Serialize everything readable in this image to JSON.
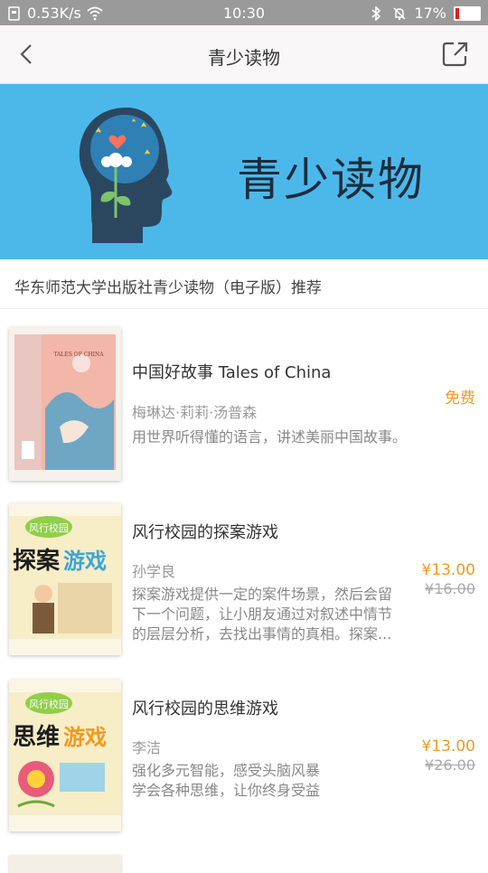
{
  "status_bar": {
    "speed": "0.53K/s",
    "time": "10:30",
    "battery": "17%",
    "battery_level": 0.17
  },
  "nav": {
    "title": "青少读物"
  },
  "banner": {
    "title": "青少读物",
    "bg_color": "#4cb8ea"
  },
  "section": {
    "description": "华东师范大学出版社青少读物（电子版）推荐"
  },
  "books": [
    {
      "title": "中国好故事 Tales of China",
      "author": "梅琳达·莉莉·汤普森",
      "desc": "用世界听得懂的语言，讲述美丽中国故事。",
      "price": "免费",
      "cover_title": "TALES OF CHINA"
    },
    {
      "title": "风行校园的探案游戏",
      "author": "孙学良",
      "desc_line1": "探案游戏提供一定的案件场景，然后会留",
      "desc_line2": "下一个问题，让小朋友通过对叙述中情节",
      "desc_line3": "的层层分析，去找出事情的真相。探案...",
      "price": "¥13.00",
      "original_price": "¥16.00",
      "cover_brand": "风行校园",
      "cover_title_a": "探案",
      "cover_title_b": "游戏"
    },
    {
      "title": "风行校园的思维游戏",
      "author": "李洁",
      "desc_line1": "强化多元智能，感受头脑风暴",
      "desc_line2": "学会各种思维，让你终身受益",
      "price": "¥13.00",
      "original_price": "¥26.00",
      "cover_brand": "风行校园",
      "cover_title_a": "思维",
      "cover_title_b": "游戏"
    }
  ],
  "colors": {
    "accent": "#f29a1e",
    "statusbar": "#9a9a9a"
  }
}
